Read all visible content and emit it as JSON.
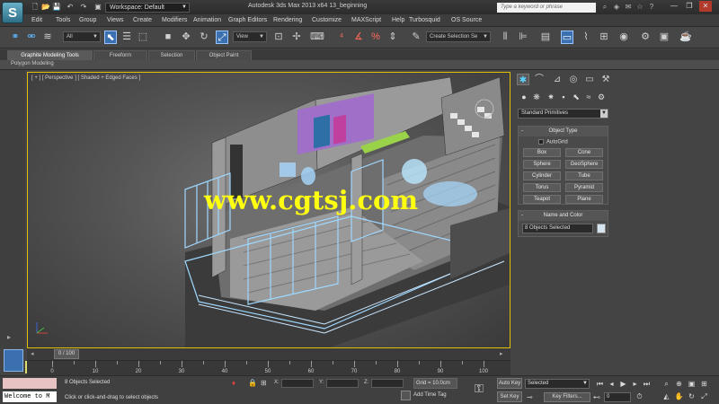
{
  "titlebar": {
    "app_logo": "S",
    "workspace": "Workspace: Default",
    "title": "Autodesk 3ds Max  2013 x64      13_beginning",
    "search_placeholder": "Type a keyword or phrase",
    "quick_access": [
      "new-icon",
      "open-icon",
      "save-icon",
      "undo-icon",
      "redo-icon",
      "project-folder-icon"
    ],
    "window_buttons": {
      "minimize": "—",
      "maximize": "❐",
      "close": "✕"
    }
  },
  "menu": [
    "Edit",
    "Tools",
    "Group",
    "Views",
    "Create",
    "Modifiers",
    "Animation",
    "Graph Editors",
    "Rendering",
    "Customize",
    "MAXScript",
    "Help",
    "Turbosquid",
    "OS Source"
  ],
  "toolbar": {
    "selection_filter": "All",
    "reference_coord": "View",
    "named_selection": "Create Selection Se"
  },
  "ribbon": {
    "tabs": [
      "Graphite Modeling Tools",
      "Freeform",
      "Selection",
      "Object Paint"
    ],
    "active_tab": 0,
    "sub_label": "Polygon Modeling"
  },
  "viewport": {
    "label": "[ + ] [ Perspective ] [ Shaded + Edged Faces ]",
    "watermark": "www.cgtsj.com",
    "border_color": "#e0c000"
  },
  "command_panel": {
    "category": "Standard Primitives",
    "object_type_title": "Object Type",
    "autogrid_label": "AutoGrid",
    "primitives": [
      "Box",
      "Cone",
      "Sphere",
      "GeoSphere",
      "Cylinder",
      "Tube",
      "Torus",
      "Pyramid",
      "Teapot",
      "Plane"
    ],
    "name_color_title": "Name and Color",
    "name_value": "8 Objects Selected",
    "rollout_toggle": "-"
  },
  "timeline": {
    "frame_display": "0 / 100",
    "ticks": [
      0,
      10,
      20,
      30,
      40,
      50,
      60,
      70,
      80,
      90,
      100
    ]
  },
  "status": {
    "listener_text": "Welcome to M",
    "selection_info": "8 Objects Selected",
    "prompt": "Click or click-and-drag to select objects",
    "coord_labels": [
      "X:",
      "Y:",
      "Z:"
    ],
    "grid": "Grid = 10.0cm",
    "add_time_tag": "Add Time Tag",
    "auto_key": "Auto Key",
    "set_key": "Set Key",
    "selected_mode": "Selected",
    "key_filters": "Key Filters...",
    "current_frame": "0"
  }
}
